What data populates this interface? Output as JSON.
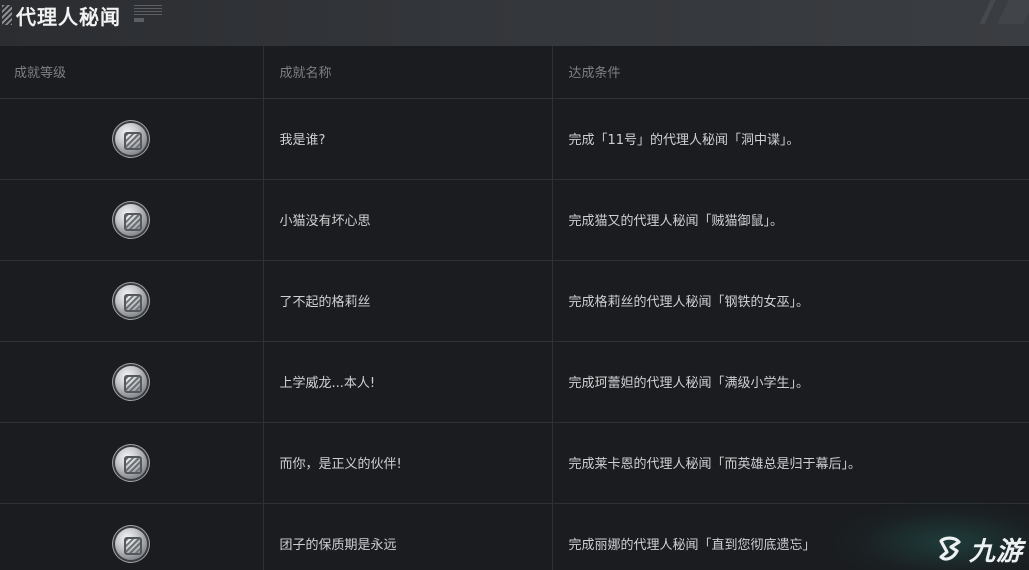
{
  "header": {
    "title": "代理人秘闻"
  },
  "table": {
    "columns": [
      "成就等级",
      "成就名称",
      "达成条件"
    ],
    "rows": [
      {
        "badge": "silver-badge-icon",
        "name": "我是谁?",
        "condition": "完成「11号」的代理人秘闻「洞中谍」。"
      },
      {
        "badge": "silver-badge-icon",
        "name": "小猫没有坏心思",
        "condition": "完成猫又的代理人秘闻「贼猫御鼠」。"
      },
      {
        "badge": "silver-badge-icon",
        "name": "了不起的格莉丝",
        "condition": "完成格莉丝的代理人秘闻「钢铁的女巫」。"
      },
      {
        "badge": "silver-badge-icon",
        "name": "上学威龙...本人!",
        "condition": "完成珂蕾妲的代理人秘闻「满级小学生」。"
      },
      {
        "badge": "silver-badge-icon",
        "name": "而你，是正义的伙伴!",
        "condition": "完成莱卡恩的代理人秘闻「而英雄总是归于幕后」。"
      },
      {
        "badge": "silver-badge-icon",
        "name": "团子的保质期是永远",
        "condition": "完成丽娜的代理人秘闻「直到您彻底遗忘」"
      }
    ]
  },
  "watermark": {
    "text": "九游",
    "icon": "jiuyou-logo-icon"
  },
  "colors": {
    "background": "#1a1c1f",
    "header": "#33363a",
    "border": "#2d3034",
    "header_text": "#7d7f83",
    "body_text": "#cfd0d2"
  }
}
